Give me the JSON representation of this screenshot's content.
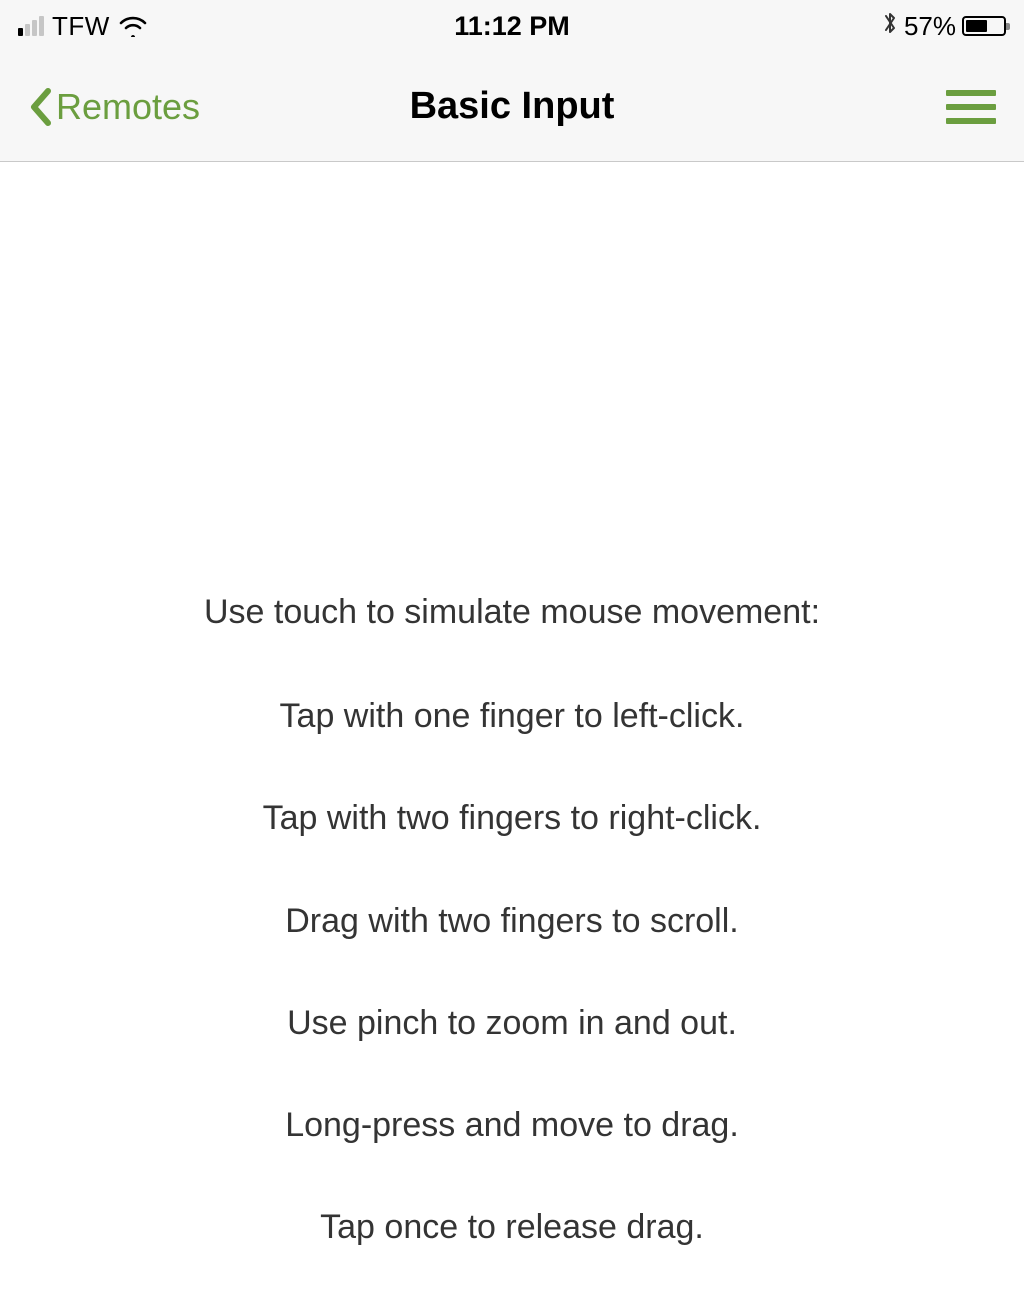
{
  "statusbar": {
    "carrier": "TFW",
    "time": "11:12 PM",
    "battery_pct": "57%"
  },
  "nav": {
    "back_label": "Remotes",
    "title": "Basic Input"
  },
  "instructions": {
    "line0": "Use touch to simulate mouse movement:",
    "line1": "Tap with one finger to left-click.",
    "line2": "Tap with two fingers to right-click.",
    "line3": "Drag with two fingers to scroll.",
    "line4": "Use pinch to zoom in and out.",
    "line5": "Long-press and move to drag.",
    "line6": "Tap once to release drag."
  },
  "colors": {
    "accent": "#6b9e3f"
  }
}
